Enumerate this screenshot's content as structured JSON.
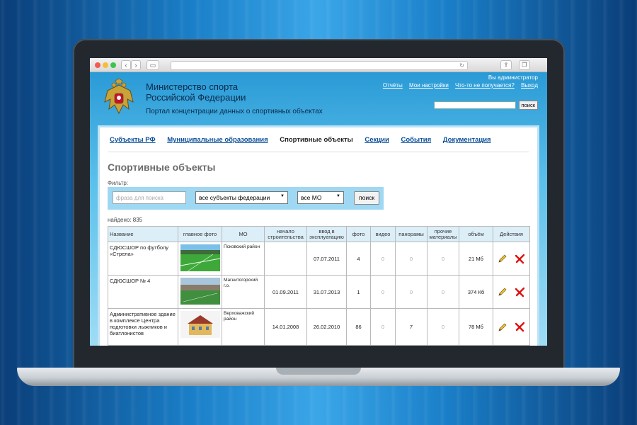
{
  "site": {
    "title_line1": "Министерство спорта",
    "title_line2": "Российской Федерации",
    "subtitle": "Портал концентрации данных о спортивных объектах",
    "user_info": "Вы администратор",
    "links": [
      "Отчёты",
      "Мои настройки",
      "Что-то не получается?",
      "Выход"
    ],
    "search_button": "поиск"
  },
  "menu": {
    "items": [
      {
        "label": "Субъекты РФ",
        "active": false
      },
      {
        "label": "Муниципальные образования",
        "active": false
      },
      {
        "label": "Спортивные объекты",
        "active": true
      },
      {
        "label": "Секции",
        "active": false
      },
      {
        "label": "События",
        "active": false
      },
      {
        "label": "Документация",
        "active": false
      }
    ]
  },
  "page": {
    "title": "Спортивные объекты",
    "filter_label": "Фильтр:",
    "search_placeholder": "фраза для поиска",
    "subject_select": "все субъекты федерации",
    "mo_select": "все МО",
    "search_button": "поиск",
    "found": "найдено: 835"
  },
  "table": {
    "columns": [
      "Название",
      "главное фото",
      "МО",
      "начало строительства",
      "ввод в эксплуатацию",
      "фото",
      "видео",
      "панорамы",
      "прочие материалы",
      "объём",
      "Действия"
    ],
    "rows": [
      {
        "name": "СДЮСШОР по футболу «Стрела»",
        "mo": "Псковский район",
        "start": "",
        "commission": "07.07.2011",
        "photo": "4",
        "video": "0",
        "panoramas": "0",
        "other": "0",
        "volume": "21 Мб",
        "img": "field-green"
      },
      {
        "name": "СДЮСШОР № 4",
        "mo": "Магнитогорский г.о.",
        "start": "01.09.2011",
        "commission": "31.07.2013",
        "photo": "1",
        "video": "0",
        "panoramas": "0",
        "other": "0",
        "volume": "374 Кб",
        "img": "stadium"
      },
      {
        "name": "Административное здание в комплексе Центра подготовки лыжников и биатлонистов",
        "mo": "Верховажский район",
        "start": "14.01.2008",
        "commission": "26.02.2010",
        "photo": "86",
        "video": "0",
        "panoramas": "7",
        "other": "0",
        "volume": "78 Мб",
        "img": "building"
      }
    ]
  },
  "icons": {
    "edit": "pencil-icon",
    "delete": "red-cross-icon"
  },
  "colors": {
    "link": "#0a4f9a",
    "header_bg": "#2a9ad6",
    "delete": "#e01010"
  }
}
